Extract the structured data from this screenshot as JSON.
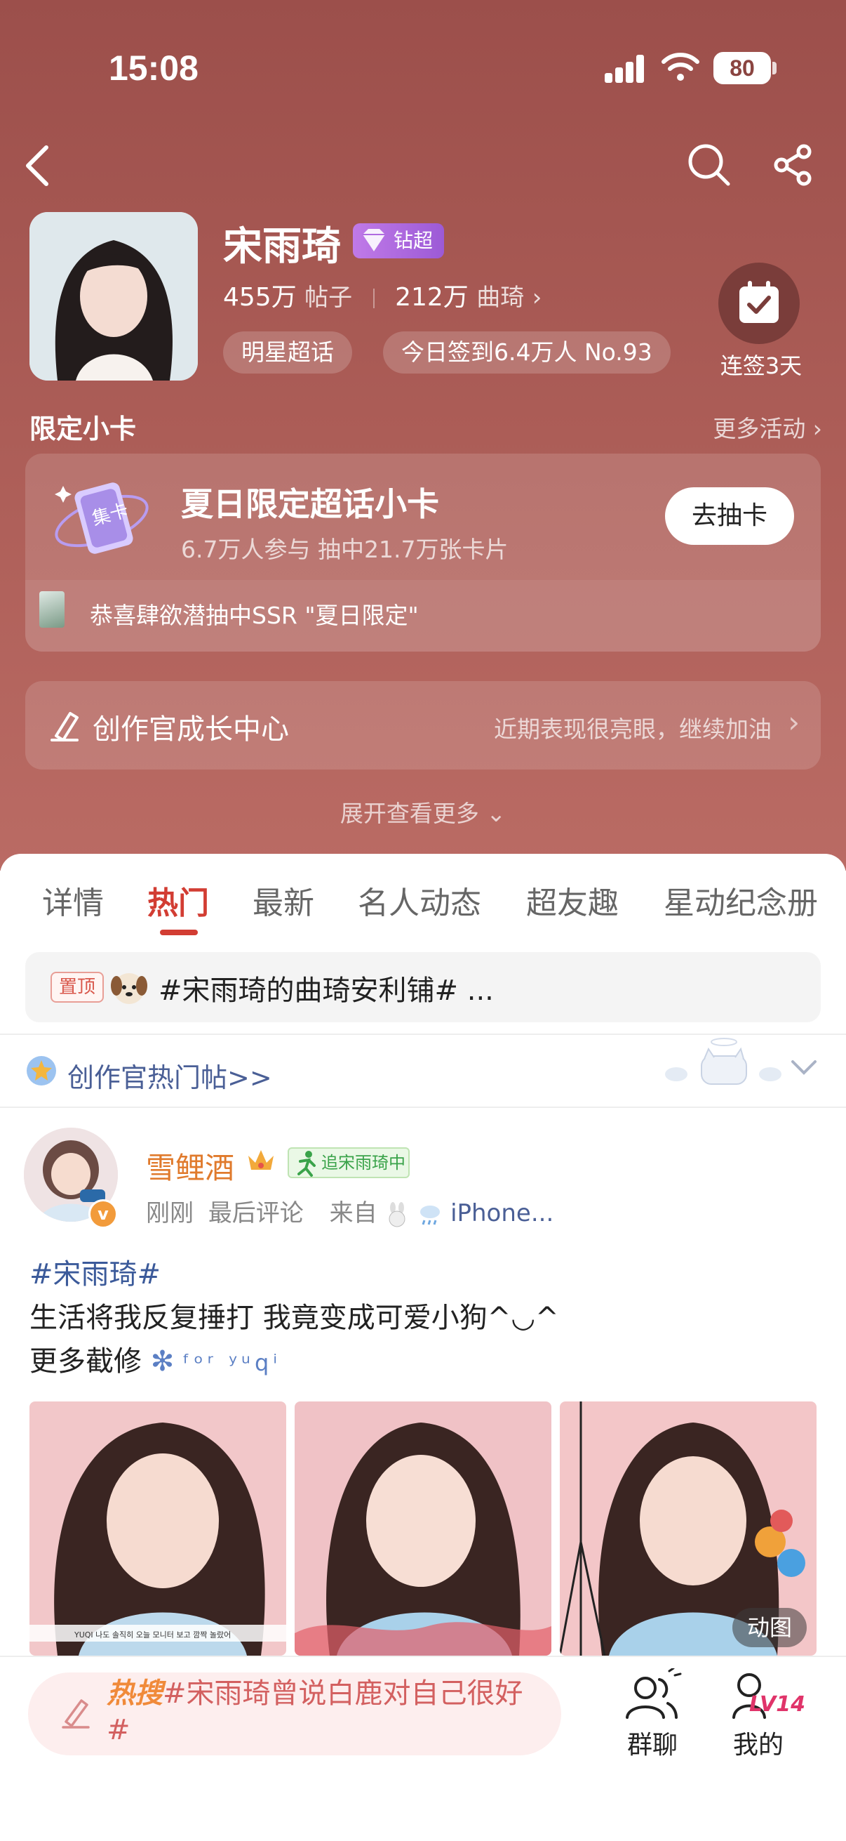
{
  "status_bar": {
    "time": "15:08",
    "battery": "80"
  },
  "header": {
    "back": "back",
    "search": "search",
    "share": "share"
  },
  "profile": {
    "name": "宋雨琦",
    "badge": "钻超",
    "posts_count": "455万",
    "posts_label": "帖子",
    "fans_count": "212万",
    "fans_label": "曲琦",
    "category": "明星超话",
    "checkin_today": "今日签到6.4万人 No.93",
    "streak": "连签3天"
  },
  "limited": {
    "title": "限定小卡",
    "more": "更多活动",
    "card_title": "夏日限定超话小卡",
    "card_sub": "6.7万人参与 抽中21.7万张卡片",
    "draw_button": "去抽卡",
    "congrats": "恭喜肆欲潜抽中SSR \"夏日限定\""
  },
  "growth": {
    "title": "创作官成长中心",
    "hint": "近期表现很亮眼，继续加油"
  },
  "expand": "展开查看更多",
  "tabs": [
    {
      "label": "详情"
    },
    {
      "label": "热门"
    },
    {
      "label": "最新"
    },
    {
      "label": "名人动态"
    },
    {
      "label": "超友趣"
    },
    {
      "label": "星动纪念册"
    }
  ],
  "pinned": {
    "tag": "置顶",
    "text": "#宋雨琦的曲琦安利铺# ..."
  },
  "creator_hot": "创作官热门帖>>",
  "post": {
    "username": "雪鲤酒",
    "follow_badge": "追宋雨琦中",
    "time": "刚刚",
    "last_comment": "最后评论",
    "from": "来自",
    "device": "iPhone...",
    "hashtag": "#宋雨琦#",
    "line1": "生活将我反复捶打 我竟变成可爱小狗^◡^",
    "line2_prefix": "更多截修",
    "line2_deco": "ᶠᵒʳ ʸᵘqⁱ",
    "photo_caption": "YUQI 나도 솔직히 오늘 모니터 보고 깜짝 놀랐어",
    "gif_tag": "动图"
  },
  "bottom": {
    "compose_hot": "热搜",
    "compose_text": "#宋雨琦曾说白鹿对自己很好#",
    "group_chat": "群聊",
    "mine": "我的",
    "level": "LV14"
  }
}
